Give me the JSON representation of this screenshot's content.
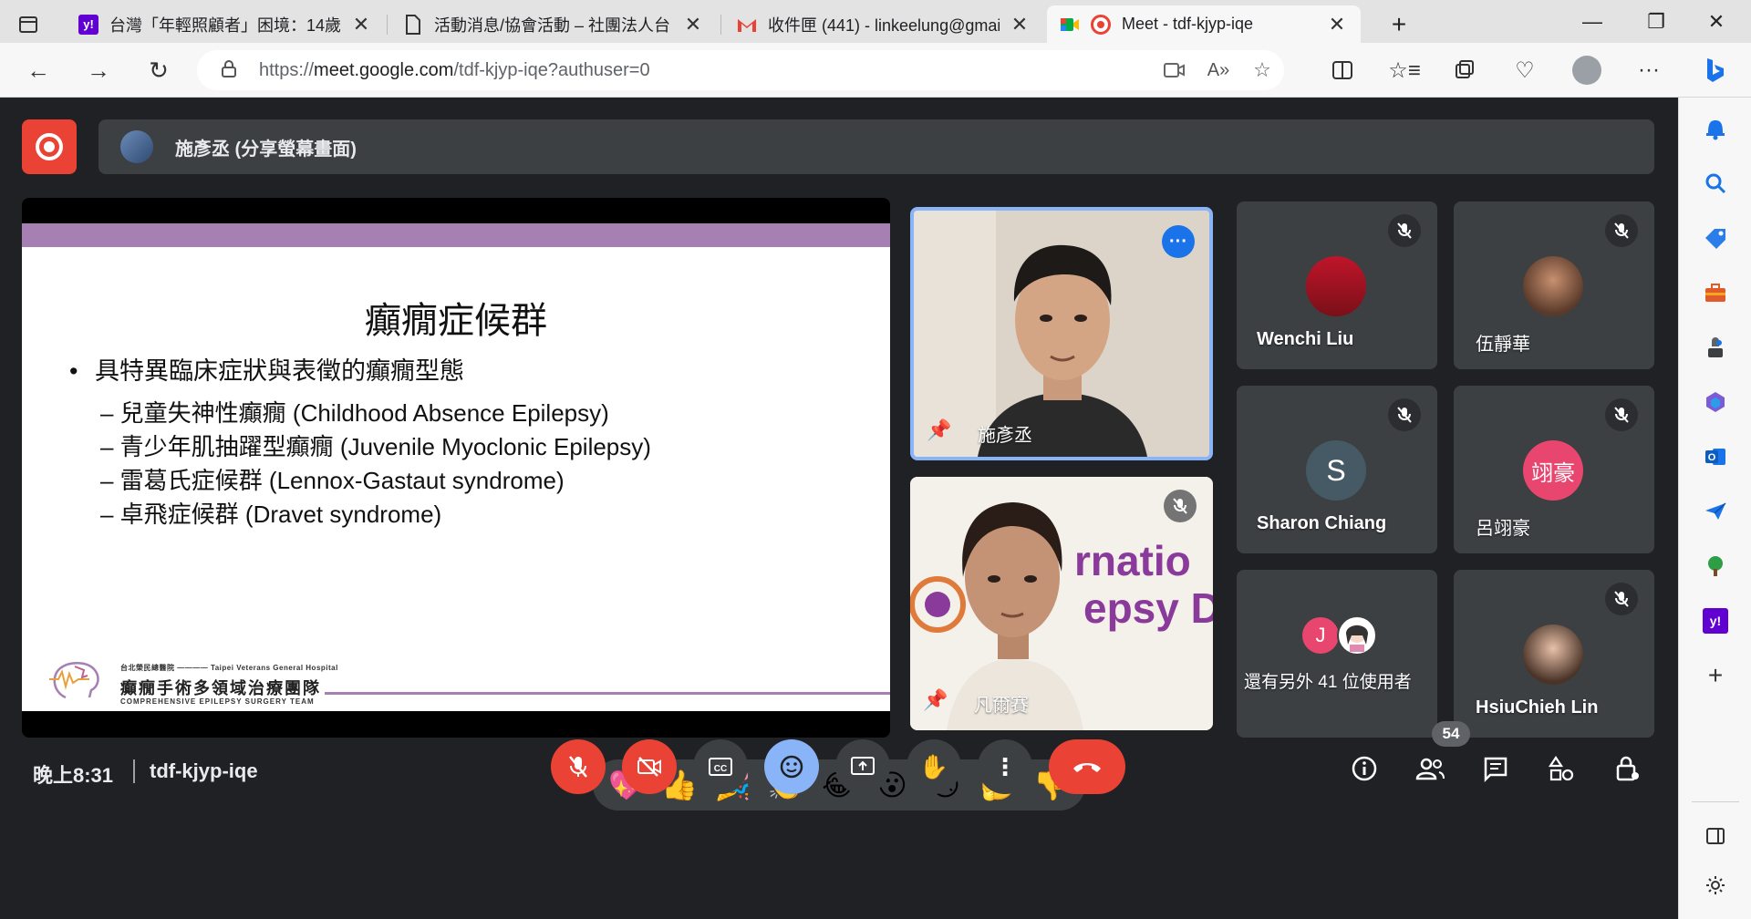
{
  "browser": {
    "tabs": [
      {
        "title": "台灣「年輕照顧者」困境：14歲",
        "favicon": "y!"
      },
      {
        "title": "活動消息/協會活動 – 社團法人台",
        "favicon": "doc"
      },
      {
        "title": "收件匣 (441) - linkeelung@gmail",
        "favicon": "M"
      },
      {
        "title": "Meet - tdf-kjyp-iqe",
        "favicon": "meet"
      }
    ],
    "url_prefix": "https://",
    "url_host": "meet.google.com",
    "url_path": "/tdf-kjyp-iqe?authuser=0"
  },
  "meet": {
    "presenter_banner": "施彥丞 (分享螢幕畫面)",
    "slide": {
      "title": "癲癇症候群",
      "bullet": "具特異臨床症狀與表徵的癲癇型態",
      "subitems": [
        "– 兒童失神性癲癇 (Childhood Absence Epilepsy)",
        "– 青少年肌抽躍型癲癇 (Juvenile Myoclonic Epilepsy)",
        "– 雷葛氏症候群 (Lennox-Gastaut syndrome)",
        "– 卓飛症候群 (Dravet syndrome)"
      ],
      "org_small": "台北榮民總醫院 ———— Taipei Veterans General Hospital",
      "org_name": "癲癇手術多領域治療團隊",
      "org_en": "COMPREHENSIVE EPILEPSY SURGERY TEAM"
    },
    "participants": {
      "speaker": "施彥丞",
      "second": "凡爾賽",
      "wenchi": "Wenchi Liu",
      "wu": "伍靜華",
      "sharon": "Sharon Chiang",
      "sharon_initial": "S",
      "lu": "呂翊豪",
      "lu_initial": "翊豪",
      "others": "還有另外 41 位使用者",
      "others_initial": "J",
      "hsiu": "HsiuChieh Lin"
    },
    "reactions": [
      "💖",
      "👍",
      "🎉",
      "👏",
      "😂",
      "😮",
      "😢",
      "🤔",
      "👎"
    ],
    "time": "晚上8:31",
    "code": "tdf-kjyp-iqe",
    "people_count": "54",
    "colors": {
      "accent_red": "#ea4335",
      "accent_blue": "#8ab4f8",
      "slide_purple": "#a680b2",
      "lu_avatar": "#e8466e",
      "sharon_avatar": "#455a64"
    }
  }
}
